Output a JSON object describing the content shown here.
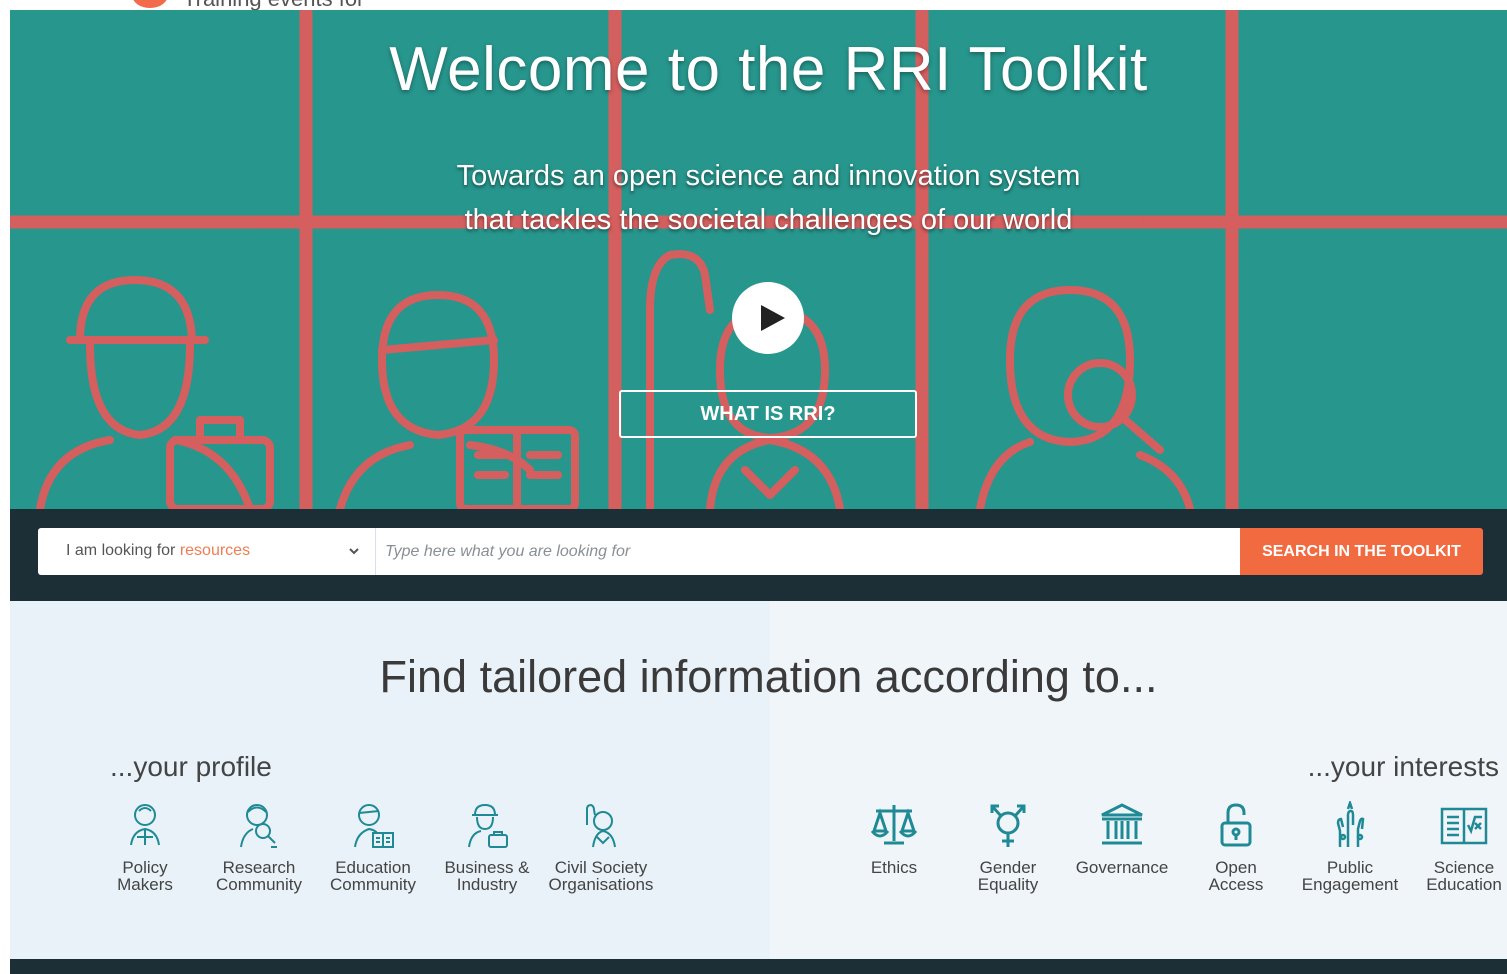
{
  "top_strip": {
    "text": "Training events for"
  },
  "hero": {
    "title": "Welcome to the RRI Toolkit",
    "subtitle_line1": "Towards an open science and innovation system",
    "subtitle_line2": "that tackles the societal challenges of our world",
    "cta_label": "WHAT IS RRI?",
    "play_icon": "play-icon"
  },
  "search": {
    "select_prefix": "I am looking for ",
    "select_value": "resources",
    "input_placeholder": "Type here what you are looking for",
    "button_label": "SEARCH IN THE TOOLKIT"
  },
  "tailored": {
    "heading": "Find tailored information according to...",
    "profile_heading": "...your profile",
    "interests_heading": "...your interests",
    "profiles": [
      {
        "line1": "Policy",
        "line2": "Makers",
        "icon": "policy-makers-icon"
      },
      {
        "line1": "Research",
        "line2": "Community",
        "icon": "research-community-icon"
      },
      {
        "line1": "Education",
        "line2": "Community",
        "icon": "education-community-icon"
      },
      {
        "line1": "Business &",
        "line2": "Industry",
        "icon": "business-industry-icon"
      },
      {
        "line1": "Civil Society",
        "line2": "Organisations",
        "icon": "civil-society-icon"
      }
    ],
    "interests": [
      {
        "line1": "Ethics",
        "line2": "",
        "icon": "ethics-scales-icon"
      },
      {
        "line1": "Gender",
        "line2": "Equality",
        "icon": "gender-symbol-icon"
      },
      {
        "line1": "Governance",
        "line2": "",
        "icon": "governance-building-icon"
      },
      {
        "line1": "Open",
        "line2": "Access",
        "icon": "open-padlock-icon"
      },
      {
        "line1": "Public",
        "line2": "Engagement",
        "icon": "raised-hands-icon"
      },
      {
        "line1": "Science",
        "line2": "Education",
        "icon": "open-book-icon"
      }
    ]
  },
  "colors": {
    "hero_teal": "#2a9a91",
    "hero_red_lines": "#e8595a",
    "dark_bar": "#1c2e36",
    "accent_orange": "#f26a3f",
    "icon_teal": "#1f8a96"
  }
}
